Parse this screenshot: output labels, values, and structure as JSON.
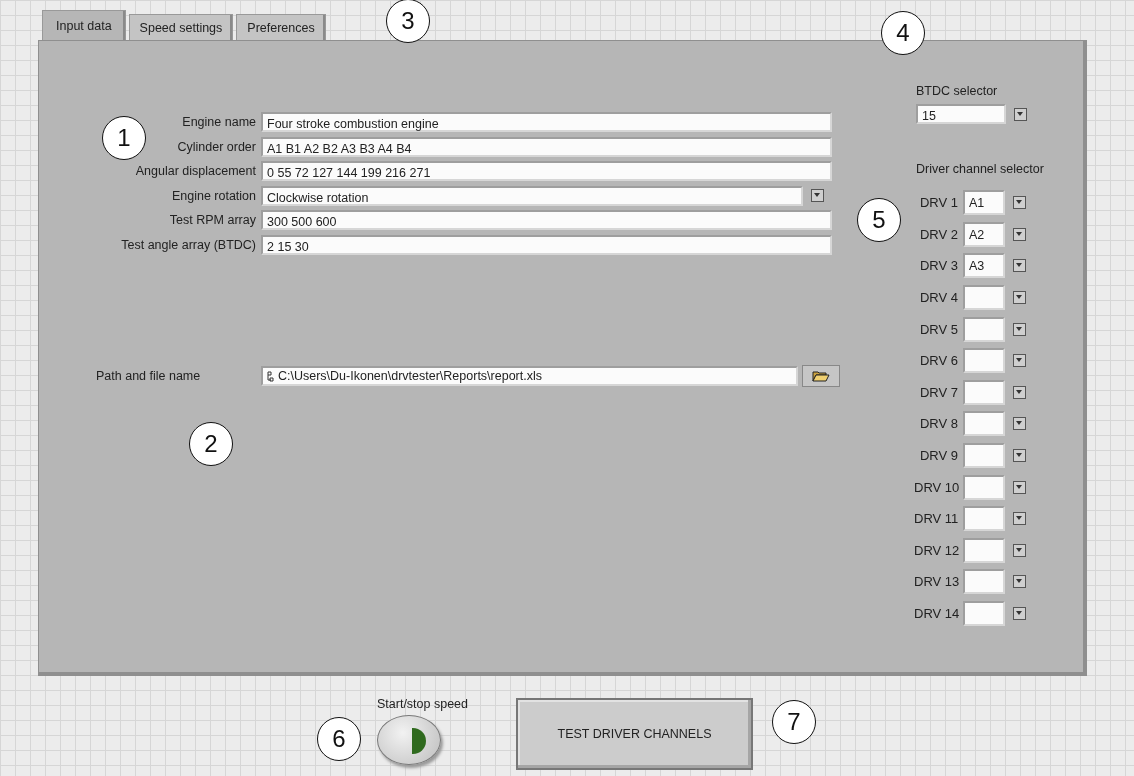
{
  "tabs": [
    {
      "label": "Input data",
      "selected": true
    },
    {
      "label": "Speed settings",
      "selected": false
    },
    {
      "label": "Preferences",
      "selected": false
    }
  ],
  "form": [
    {
      "kind": "text",
      "label": "Engine name",
      "value": "Four stroke combustion engine"
    },
    {
      "kind": "text",
      "label": "Cylinder order",
      "value": "A1 B1 A2 B2 A3 B3 A4 B4"
    },
    {
      "kind": "text",
      "label": "Angular displacement",
      "value": "0 55 72 127 144 199 216 271"
    },
    {
      "kind": "dropdown",
      "label": "Engine rotation",
      "value": "Clockwise rotation"
    },
    {
      "kind": "text",
      "label": "Test RPM array",
      "value": "300 500 600"
    },
    {
      "kind": "text",
      "label": "Test angle array (BTDC)",
      "value": "2 15 30"
    }
  ],
  "path": {
    "label": "Path and file name",
    "value": "C:\\Users\\Du-Ikonen\\drvtester\\Reports\\report.xls"
  },
  "btdc": {
    "label": "BTDC selector",
    "value": "15"
  },
  "driver_channels": {
    "title": "Driver channel selector",
    "rows": [
      {
        "label": "DRV 1",
        "value": "A1"
      },
      {
        "label": "DRV 2",
        "value": "A2"
      },
      {
        "label": "DRV 3",
        "value": "A3"
      },
      {
        "label": "DRV 4"
      },
      {
        "label": "DRV 5"
      },
      {
        "label": "DRV 6"
      },
      {
        "label": "DRV 7"
      },
      {
        "label": "DRV 8"
      },
      {
        "label": "DRV 9"
      },
      {
        "label": "DRV 10"
      },
      {
        "label": "DRV 11"
      },
      {
        "label": "DRV 12"
      },
      {
        "label": "DRV 13"
      },
      {
        "label": "DRV 14"
      }
    ]
  },
  "start_stop": {
    "label": "Start/stop speed"
  },
  "test_button": "TEST DRIVER CHANNELS",
  "callouts": [
    "1",
    "2",
    "3",
    "4",
    "5",
    "6",
    "7"
  ]
}
